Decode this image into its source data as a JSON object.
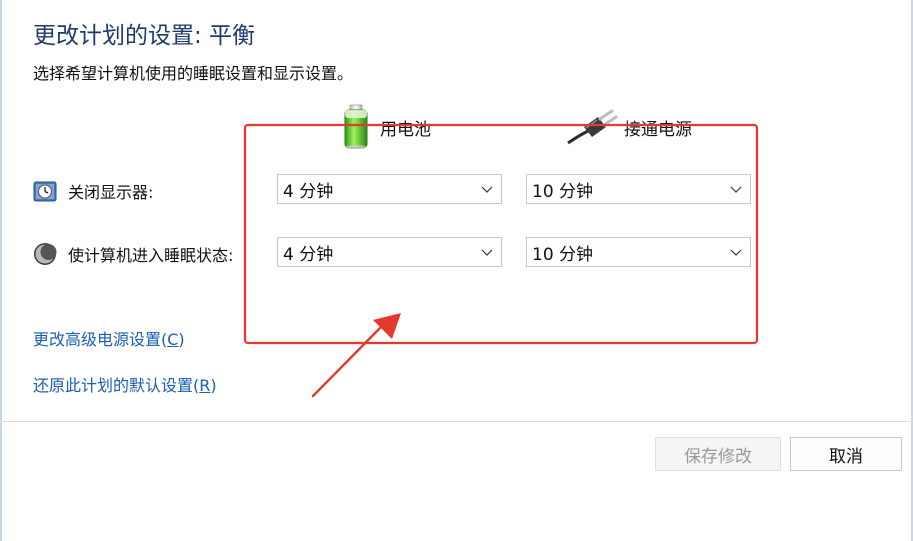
{
  "dialog": {
    "title": "更改计划的设置: 平衡",
    "subtitle": "选择希望计算机使用的睡眠设置和显示设置。"
  },
  "columns": {
    "battery_label": "用电池",
    "plugged_label": "接通电源",
    "battery_icon": "battery-icon",
    "plug_icon": "power-plug-icon"
  },
  "rows": {
    "display": {
      "label": "关闭显示器:",
      "icon": "clock-icon",
      "battery_value": "4 分钟",
      "plugged_value": "10 分钟"
    },
    "sleep": {
      "label": "使计算机进入睡眠状态:",
      "icon": "moon-icon",
      "battery_value": "4 分钟",
      "plugged_value": "10 分钟"
    }
  },
  "links": {
    "advanced_pre": "更改高级电源设置(",
    "advanced_key": "C",
    "advanced_post": ")",
    "restore_pre": "还原此计划的默认设置(",
    "restore_key": "R",
    "restore_post": ")"
  },
  "buttons": {
    "save": "保存修改",
    "cancel": "取消"
  },
  "colors": {
    "title": "#1e3a6e",
    "link": "#1a5fb4",
    "annotation": "#e23a2c"
  }
}
